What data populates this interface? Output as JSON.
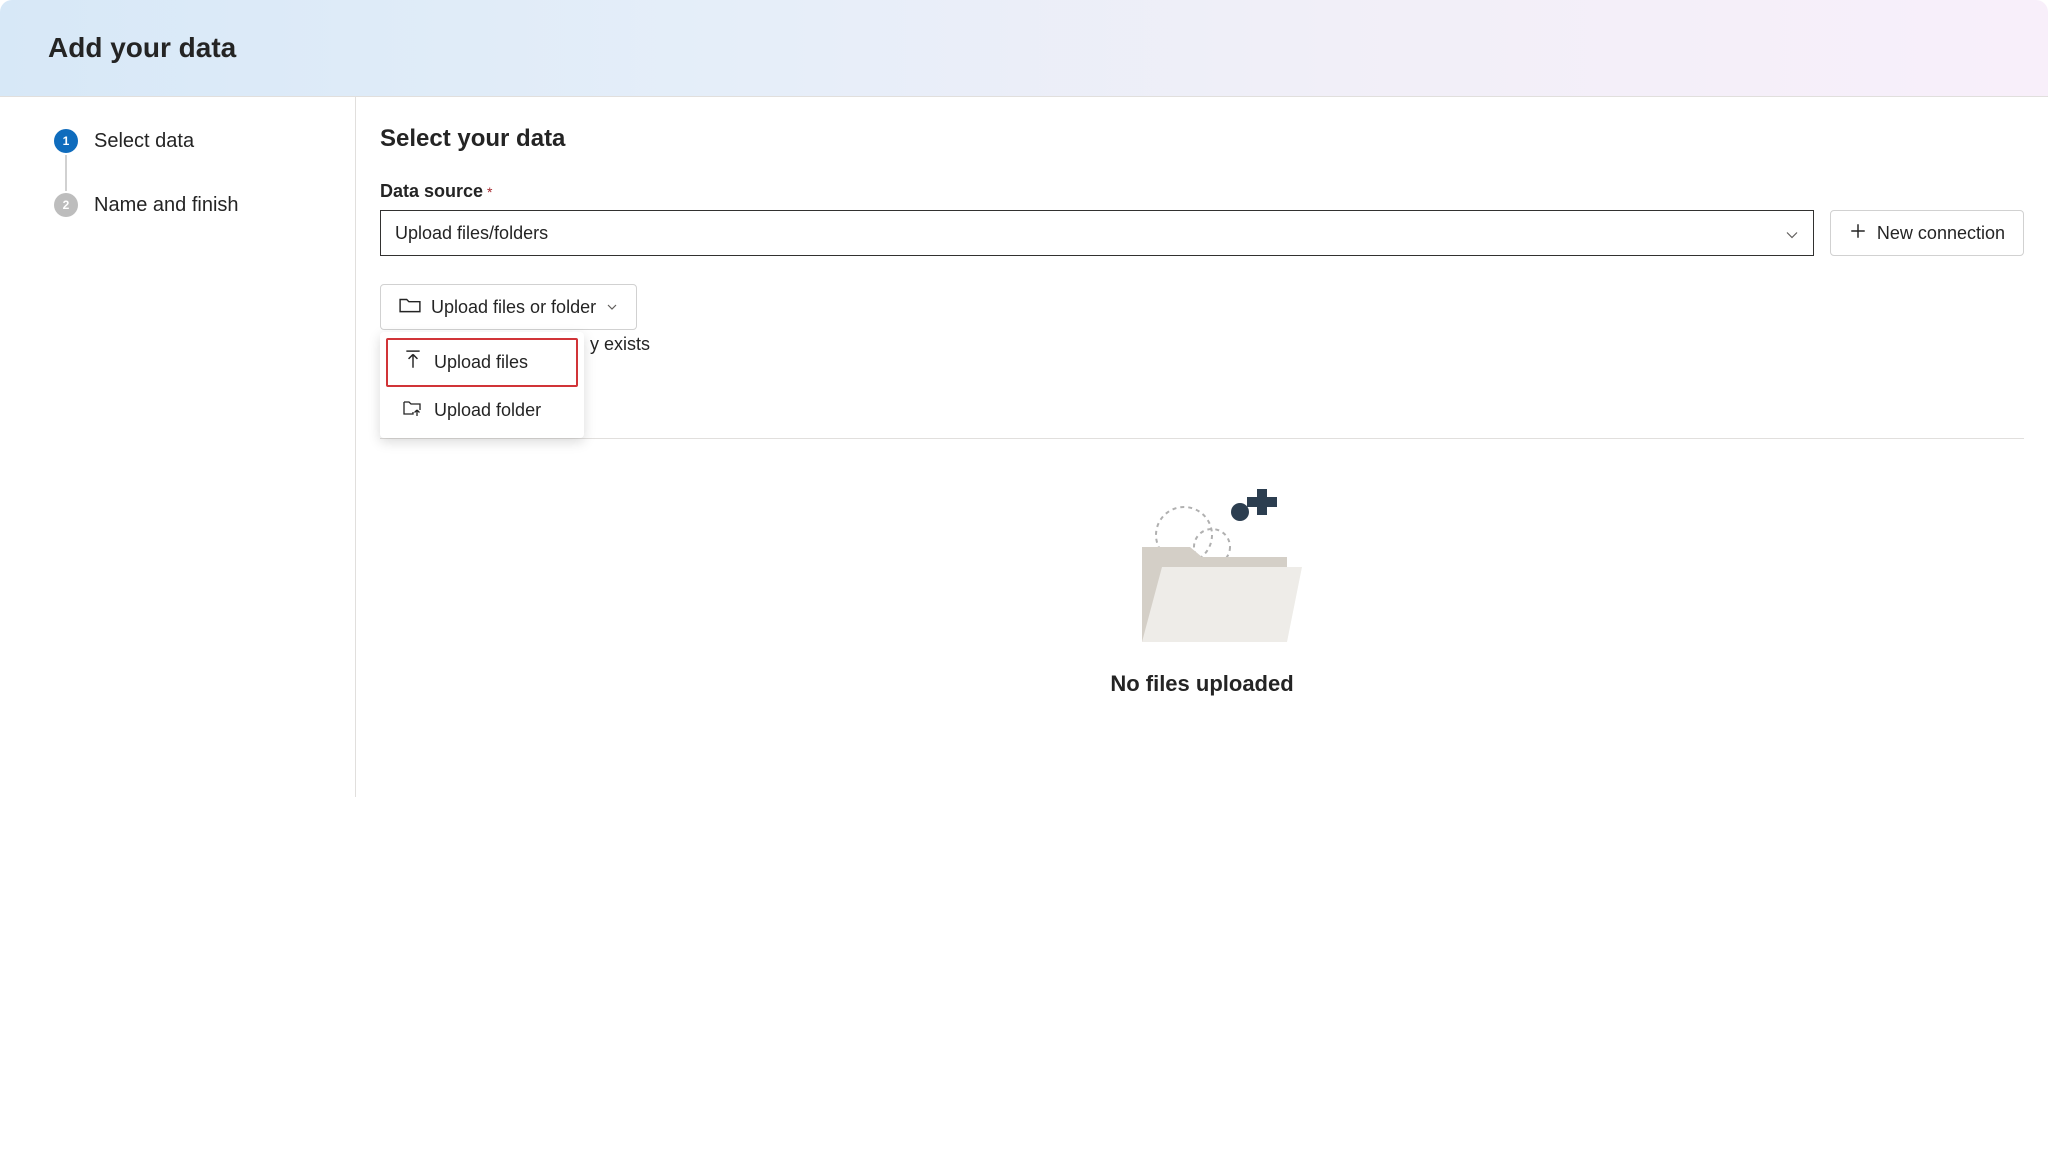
{
  "header": {
    "title": "Add your data"
  },
  "sidebar": {
    "steps": [
      {
        "num": "1",
        "label": "Select data",
        "active": true
      },
      {
        "num": "2",
        "label": "Name and finish",
        "active": false
      }
    ]
  },
  "main": {
    "title": "Select your data",
    "data_source_label": "Data source",
    "data_source_value": "Upload files/folders",
    "new_connection_label": "New connection",
    "upload_button_label": "Upload files or folder",
    "dropdown": {
      "upload_files": "Upload files",
      "upload_folder": "Upload folder"
    },
    "behind_text": "y exists",
    "empty_state_text": "No files uploaded"
  }
}
